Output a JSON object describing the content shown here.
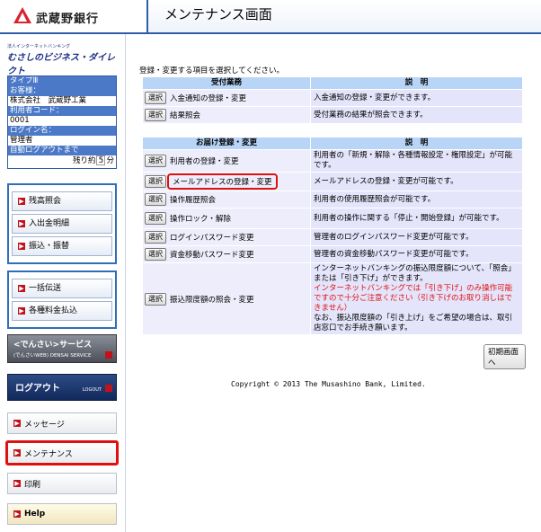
{
  "header": {
    "bank_name": "武蔵野銀行",
    "page_title": "メンテナンス画面"
  },
  "brand": {
    "line1": "法人インターネットバンキング",
    "line2": "むさしのビジネス・ダイレクト"
  },
  "user_info": {
    "type_label": "タイプⅢ",
    "company_label": "お客様：",
    "company_value": "株式会社　武蔵野工業",
    "user_code_label": "利用者コード：",
    "user_code_value": "0001",
    "login_name_label": "ログイン名：",
    "login_name_value": "管理者",
    "auto_logout_label": "自動ログアウトまで",
    "remaining_prefix": "残り約",
    "remaining_value": "5",
    "remaining_unit": "分"
  },
  "nav": {
    "group1": [
      "残高照会",
      "入出金明細",
      "振込・振替"
    ],
    "group2": [
      "一括伝送",
      "各種料金払込"
    ],
    "densai_title": "<でんさい>サービス",
    "densai_sub": "(でんさいWEB)  DENSAI SERVICE",
    "logout": "ログアウト",
    "logout_sub": "LOGOUT",
    "message": "メッセージ",
    "maintenance": "メンテナンス",
    "print": "印刷",
    "help": "Help"
  },
  "main": {
    "instruction": "登録・変更する項目を選択してください。",
    "select_label": "選択",
    "table1": {
      "header_left": "受付業務",
      "header_right": "説　明",
      "rows": [
        {
          "label": "入金通知の登録・変更",
          "desc": "入金通知の登録・変更ができます。"
        },
        {
          "label": "結果照会",
          "desc": "受付業務の結果が照会できます。"
        }
      ]
    },
    "table2": {
      "header_left": "お届け登録・変更",
      "header_right": "説　明",
      "rows": [
        {
          "label": "利用者の登録・変更",
          "desc": "利用者の「新規・解除・各種情報設定・権限設定」が可能です。"
        },
        {
          "label": "メールアドレスの登録・変更",
          "desc": "メールアドレスの登録・変更が可能です。"
        },
        {
          "label": "操作履歴照会",
          "desc": "利用者の使用履歴照会が可能です。"
        },
        {
          "label": "操作ロック・解除",
          "desc": "利用者の操作に関する「停止・開始登録」が可能です。"
        },
        {
          "label": "ログインパスワード変更",
          "desc": "管理者のログインパスワード変更が可能です。"
        },
        {
          "label": "資金移動パスワード変更",
          "desc": "管理者の資金移動パスワード変更が可能です。"
        },
        {
          "label": "振込限度額の照会・変更",
          "desc_a": "インターネットバンキングの振込限度額について、「照会」または「引き下げ」ができます。",
          "desc_red": "インターネットバンキングでは「引き下げ」のみ操作可能ですので十分ご注意ください（引き下げのお取り消しはできません）",
          "desc_b": "なお、振込限度額の「引き上げ」をご希望の場合は、取引店窓口でお手続き願います。"
        }
      ]
    },
    "init_button": "初期画面へ",
    "copyright": "Copyright © 2013 The Musashino Bank, Limited."
  }
}
